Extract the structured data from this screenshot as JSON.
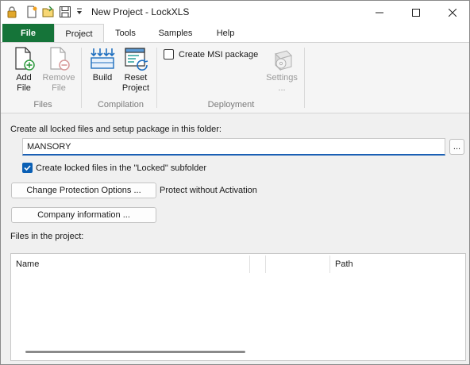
{
  "window": {
    "title": "New Project - LockXLS"
  },
  "tabs": [
    {
      "label": "File"
    },
    {
      "label": "Project"
    },
    {
      "label": "Tools"
    },
    {
      "label": "Samples"
    },
    {
      "label": "Help"
    }
  ],
  "ribbon": {
    "add_file": "Add\nFile",
    "add_file_l1": "Add",
    "add_file_l2": "File",
    "remove_file_l1": "Remove",
    "remove_file_l2": "File",
    "build": "Build",
    "reset_l1": "Reset",
    "reset_l2": "Project",
    "create_msi": "Create MSI package",
    "settings_l1": "Settings",
    "settings_l2": "...",
    "group_files": "Files",
    "group_compilation": "Compilation",
    "group_deployment": "Deployment"
  },
  "main": {
    "folder_label": "Create all locked files and setup package in this folder:",
    "folder_value": "MANSORY",
    "browse_label": "...",
    "locked_subfolder_label": "Create locked files in the \"Locked\" subfolder",
    "locked_subfolder_checked": true,
    "change_protection_label": "Change Protection Options ...",
    "protection_status": "Protect without Activation",
    "company_info_label": "Company information ...",
    "files_label": "Files in the project:"
  },
  "file_list": {
    "columns": [
      "Name",
      "",
      "",
      "Path"
    ],
    "rows": []
  },
  "colors": {
    "file_tab": "#157439",
    "accent": "#0a5fb4"
  }
}
